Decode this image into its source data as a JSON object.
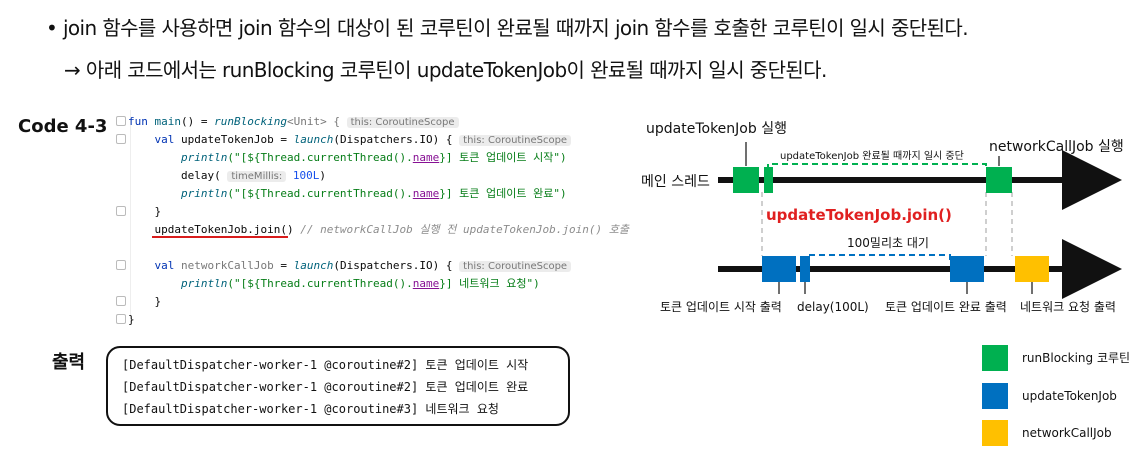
{
  "bullet_main": "• join 함수를 사용하면 join 함수의 대상이 된 코루틴이 완료될 때까지 join 함수를 호출한 코루틴이 일시 중단된다.",
  "bullet_sub": "→ 아래 코드에서는 runBlocking 코루틴이 updateTokenJob이 완료될 때까지 일시 중단된다.",
  "code_title": "Code 4-3",
  "code": {
    "l1_a": "fun ",
    "l1_fn": "main",
    "l1_b": "() = ",
    "l1_rb": "runBlocking",
    "l1_c": "<Unit> { ",
    "l1_hint": "this: CoroutineScope",
    "l2_a": "    val ",
    "l2_b": "updateTokenJob = ",
    "l2_fn": "launch",
    "l2_c": "(Dispatchers.IO) { ",
    "l2_hint": "this: CoroutineScope",
    "l3_fn": "        println",
    "l3_a": "(\"[${Thread.currentThread().",
    "l3_prop": "name",
    "l3_b": "}] 토큰 업데이트 시작\")",
    "l4_a": "        delay( ",
    "l4_hint": "timeMillis:",
    "l4_num": " 100L",
    "l4_b": ")",
    "l5_fn": "        println",
    "l5_a": "(\"[${Thread.currentThread().",
    "l5_prop": "name",
    "l5_b": "}] 토큰 업데이트 완료\")",
    "l6": "    }",
    "l7_a": "    updateTokenJob.join()",
    "l7_cm": " // networkCallJob 실행 전 updateTokenJob.join() 호출",
    "l9_a": "    val ",
    "l9_b": "networkCallJob",
    "l9_c": " = ",
    "l9_fn": "launch",
    "l9_d": "(Dispatchers.IO) { ",
    "l9_hint": "this: CoroutineScope",
    "l10_fn": "        println",
    "l10_a": "(\"[${Thread.currentThread().",
    "l10_prop": "name",
    "l10_b": "}] 네트워크 요청\")",
    "l11": "    }",
    "l12": "}"
  },
  "output_title": "출력",
  "output_lines": [
    "[DefaultDispatcher-worker-1 @coroutine#2] 토큰 업데이트 시작",
    "[DefaultDispatcher-worker-1 @coroutine#2] 토큰 업데이트 완료",
    "[DefaultDispatcher-worker-1 @coroutine#3] 네트워크 요청"
  ],
  "diagram": {
    "label_update_run": "updateTokenJob 실행",
    "label_suspend": "updateTokenJob 완료될 때까지 일시 중단",
    "label_network_run": "networkCallJob 실행",
    "label_main_thread": "메인 스레드",
    "label_join": "updateTokenJob.join()",
    "label_wait": "100밀리초 대기",
    "label_start_print": "토큰 업데이트 시작 출력",
    "label_delay": "delay(100L)",
    "label_done_print": "토큰 업데이트 완료 출력",
    "label_net_print": "네트워크 요청 출력",
    "legend": [
      {
        "label": "runBlocking 코루틴",
        "color": "#00b050"
      },
      {
        "label": "updateTokenJob",
        "color": "#0070c0"
      },
      {
        "label": "networkCallJob",
        "color": "#ffc000"
      }
    ],
    "colors": {
      "green": "#00b050",
      "blue": "#0070c0",
      "yellow": "#ffc000",
      "red": "#e02020"
    }
  }
}
